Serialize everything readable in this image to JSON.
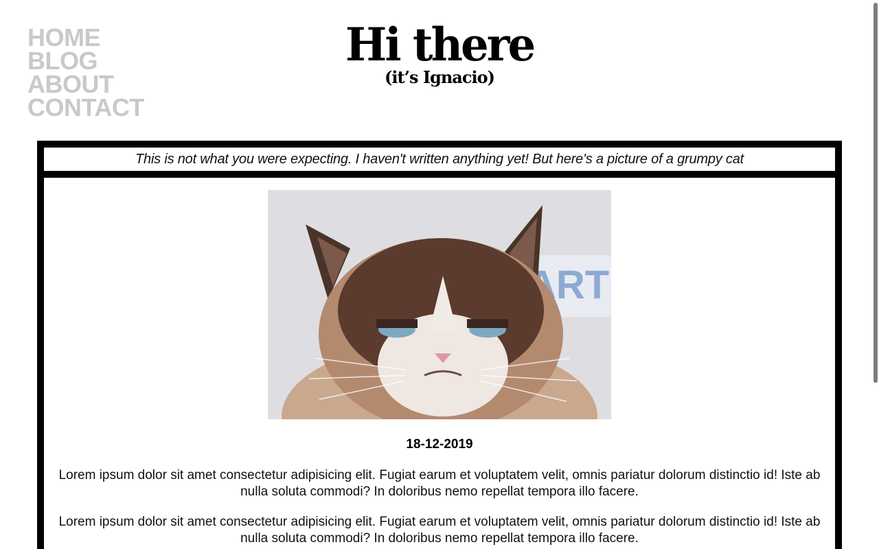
{
  "nav": {
    "items": [
      {
        "label": "HOME"
      },
      {
        "label": "BLOG"
      },
      {
        "label": "ABOUT"
      },
      {
        "label": "CONTACT"
      }
    ]
  },
  "header": {
    "title": "Hi there",
    "subtitle": "(it’s Ignacio)"
  },
  "banner": {
    "text": "This is not what you were expecting. I haven't written anything yet! But here's a picture of a grumpy cat"
  },
  "post": {
    "image_alt": "grumpy cat",
    "date": "18-12-2019",
    "paragraphs": [
      "Lorem ipsum dolor sit amet consectetur adipisicing elit. Fugiat earum et voluptatem velit, omnis pariatur dolorum distinctio id! Iste ab nulla soluta commodi? In doloribus nemo repellat tempora illo facere.",
      "Lorem ipsum dolor sit amet consectetur adipisicing elit. Fugiat earum et voluptatem velit, omnis pariatur dolorum distinctio id! Iste ab nulla soluta commodi? In doloribus nemo repellat tempora illo facere."
    ]
  },
  "colors": {
    "nav": "#c9c9c9",
    "frame": "#000000",
    "background": "#ffffff"
  }
}
